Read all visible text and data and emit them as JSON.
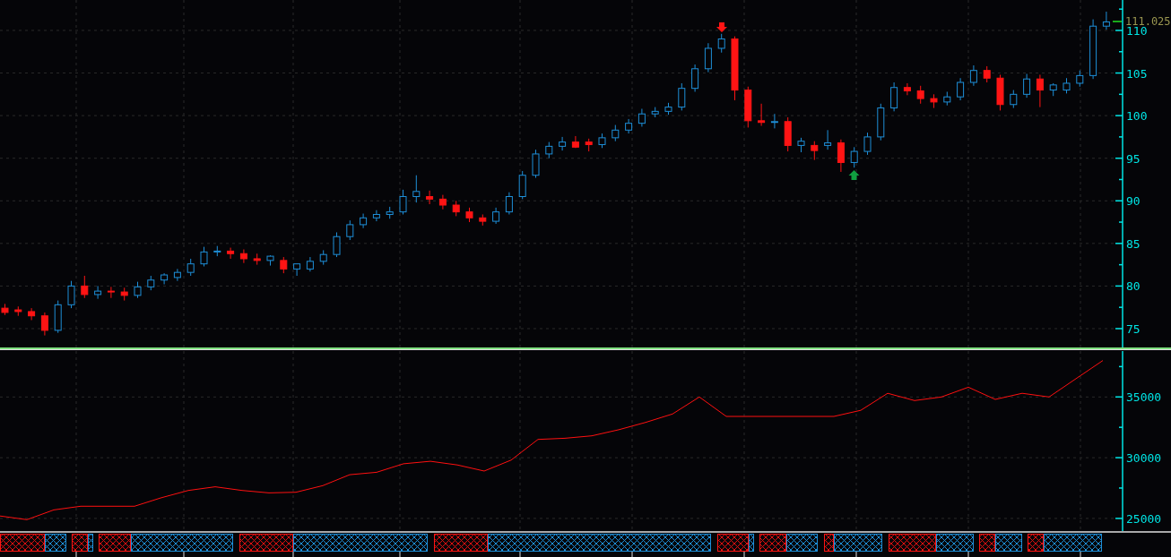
{
  "price_panel": {
    "last_price": "111.025",
    "chart_data": {
      "type": "candlestick",
      "ylim": [
        72.79,
        113.57
      ],
      "yticks": [
        75,
        80,
        85,
        90,
        95,
        100,
        105,
        110
      ],
      "grid": true,
      "ohlc": [
        [
          77.4,
          77.9,
          76.6,
          76.9
        ],
        [
          77.2,
          77.6,
          76.5,
          77.0
        ],
        [
          77.0,
          77.4,
          76.0,
          76.5
        ],
        [
          76.5,
          76.9,
          74.2,
          74.8
        ],
        [
          74.8,
          78.3,
          74.5,
          77.8
        ],
        [
          77.8,
          80.6,
          77.4,
          80.0
        ],
        [
          80.0,
          81.2,
          78.6,
          79.0
        ],
        [
          79.0,
          80.0,
          78.5,
          79.4
        ],
        [
          79.4,
          79.9,
          78.6,
          79.3
        ],
        [
          79.3,
          79.8,
          78.3,
          78.9
        ],
        [
          78.9,
          80.5,
          78.6,
          79.9
        ],
        [
          79.9,
          81.2,
          79.5,
          80.7
        ],
        [
          80.7,
          81.5,
          80.2,
          81.3
        ],
        [
          81.0,
          82.0,
          80.6,
          81.6
        ],
        [
          81.6,
          83.2,
          81.2,
          82.6
        ],
        [
          82.6,
          84.6,
          82.3,
          84.0
        ],
        [
          84.0,
          84.7,
          83.5,
          84.1
        ],
        [
          84.1,
          84.5,
          83.2,
          83.8
        ],
        [
          83.8,
          84.3,
          82.7,
          83.2
        ],
        [
          83.2,
          83.8,
          82.5,
          83.0
        ],
        [
          83.0,
          83.6,
          82.4,
          83.5
        ],
        [
          83.0,
          83.4,
          81.5,
          82.0
        ],
        [
          82.0,
          82.6,
          81.2,
          82.6
        ],
        [
          82.0,
          83.4,
          81.7,
          82.9
        ],
        [
          82.9,
          84.2,
          82.5,
          83.7
        ],
        [
          83.7,
          86.3,
          83.4,
          85.8
        ],
        [
          85.8,
          87.7,
          85.4,
          87.2
        ],
        [
          87.2,
          88.5,
          86.8,
          88.0
        ],
        [
          88.0,
          88.9,
          87.6,
          88.4
        ],
        [
          88.4,
          89.3,
          87.9,
          88.7
        ],
        [
          88.7,
          91.3,
          88.4,
          90.5
        ],
        [
          90.5,
          93.0,
          89.8,
          91.1
        ],
        [
          90.5,
          91.2,
          89.6,
          90.2
        ],
        [
          90.2,
          90.7,
          89.0,
          89.5
        ],
        [
          89.5,
          90.0,
          88.2,
          88.7
        ],
        [
          88.7,
          89.2,
          87.5,
          88.0
        ],
        [
          88.0,
          88.4,
          87.1,
          87.6
        ],
        [
          87.6,
          89.2,
          87.3,
          88.7
        ],
        [
          88.7,
          91.0,
          88.4,
          90.5
        ],
        [
          90.5,
          93.5,
          90.2,
          93.0
        ],
        [
          93.0,
          96.0,
          92.7,
          95.5
        ],
        [
          95.5,
          96.9,
          95.0,
          96.4
        ],
        [
          96.4,
          97.5,
          95.9,
          96.9
        ],
        [
          96.9,
          97.6,
          96.2,
          96.3
        ],
        [
          96.9,
          97.3,
          95.8,
          96.6
        ],
        [
          96.6,
          97.9,
          96.2,
          97.4
        ],
        [
          97.4,
          98.9,
          97.0,
          98.3
        ],
        [
          98.3,
          99.6,
          97.9,
          99.1
        ],
        [
          99.1,
          100.8,
          98.7,
          100.2
        ],
        [
          100.2,
          101.0,
          99.8,
          100.5
        ],
        [
          100.5,
          101.5,
          100.1,
          101.0
        ],
        [
          101.0,
          103.8,
          100.6,
          103.2
        ],
        [
          103.2,
          106.0,
          102.8,
          105.5
        ],
        [
          105.5,
          108.5,
          105.1,
          107.9
        ],
        [
          107.9,
          109.6,
          107.4,
          109.0
        ],
        [
          109.0,
          109.3,
          101.8,
          103.0
        ],
        [
          103.0,
          103.4,
          98.6,
          99.4
        ],
        [
          99.4,
          101.4,
          98.8,
          99.2
        ],
        [
          99.2,
          100.2,
          98.5,
          99.3
        ],
        [
          99.3,
          99.8,
          95.8,
          96.5
        ],
        [
          96.5,
          97.4,
          95.7,
          97.0
        ],
        [
          96.5,
          97.0,
          94.8,
          95.9
        ],
        [
          96.5,
          98.3,
          96.0,
          96.8
        ],
        [
          96.8,
          97.2,
          93.4,
          94.5
        ],
        [
          94.5,
          96.3,
          93.9,
          95.8
        ],
        [
          95.8,
          98.0,
          95.4,
          97.5
        ],
        [
          97.5,
          101.4,
          97.1,
          100.9
        ],
        [
          100.9,
          103.9,
          100.5,
          103.3
        ],
        [
          103.3,
          103.8,
          102.4,
          102.9
        ],
        [
          102.9,
          103.5,
          101.4,
          102.0
        ],
        [
          102.0,
          102.5,
          100.9,
          101.6
        ],
        [
          101.6,
          102.8,
          101.2,
          102.2
        ],
        [
          102.2,
          104.4,
          101.8,
          103.9
        ],
        [
          103.9,
          105.9,
          103.5,
          105.3
        ],
        [
          105.3,
          105.8,
          103.9,
          104.4
        ],
        [
          104.4,
          104.8,
          100.6,
          101.3
        ],
        [
          101.3,
          103.0,
          100.9,
          102.5
        ],
        [
          102.5,
          104.9,
          102.1,
          104.3
        ],
        [
          104.3,
          104.8,
          101.0,
          103.0
        ],
        [
          103.0,
          103.8,
          102.3,
          103.6
        ],
        [
          103.0,
          104.4,
          102.6,
          103.8
        ],
        [
          103.8,
          105.3,
          103.4,
          104.7
        ],
        [
          104.7,
          111.3,
          104.3,
          110.5
        ],
        [
          110.5,
          112.2,
          110.1,
          111.0
        ]
      ]
    }
  },
  "indicator_panel": {
    "chart_data": {
      "type": "line",
      "ylim": [
        23960,
        38780
      ],
      "yticks": [
        25000,
        30000,
        35000
      ],
      "grid": true,
      "series": [
        {
          "color": "#ff1010",
          "values": [
            25200,
            24900,
            25700,
            26000,
            26000,
            26000,
            26700,
            27300,
            27600,
            27300,
            27100,
            27150,
            27700,
            28600,
            28800,
            29500,
            29700,
            29400,
            28900,
            29800,
            31500,
            31600,
            31800,
            32300,
            32900,
            33600,
            35000,
            33400,
            33400,
            33400,
            33400,
            33400,
            33900,
            35300,
            34700,
            35000,
            35800,
            34800,
            35300,
            35000,
            36500,
            38000
          ]
        }
      ]
    }
  }
}
